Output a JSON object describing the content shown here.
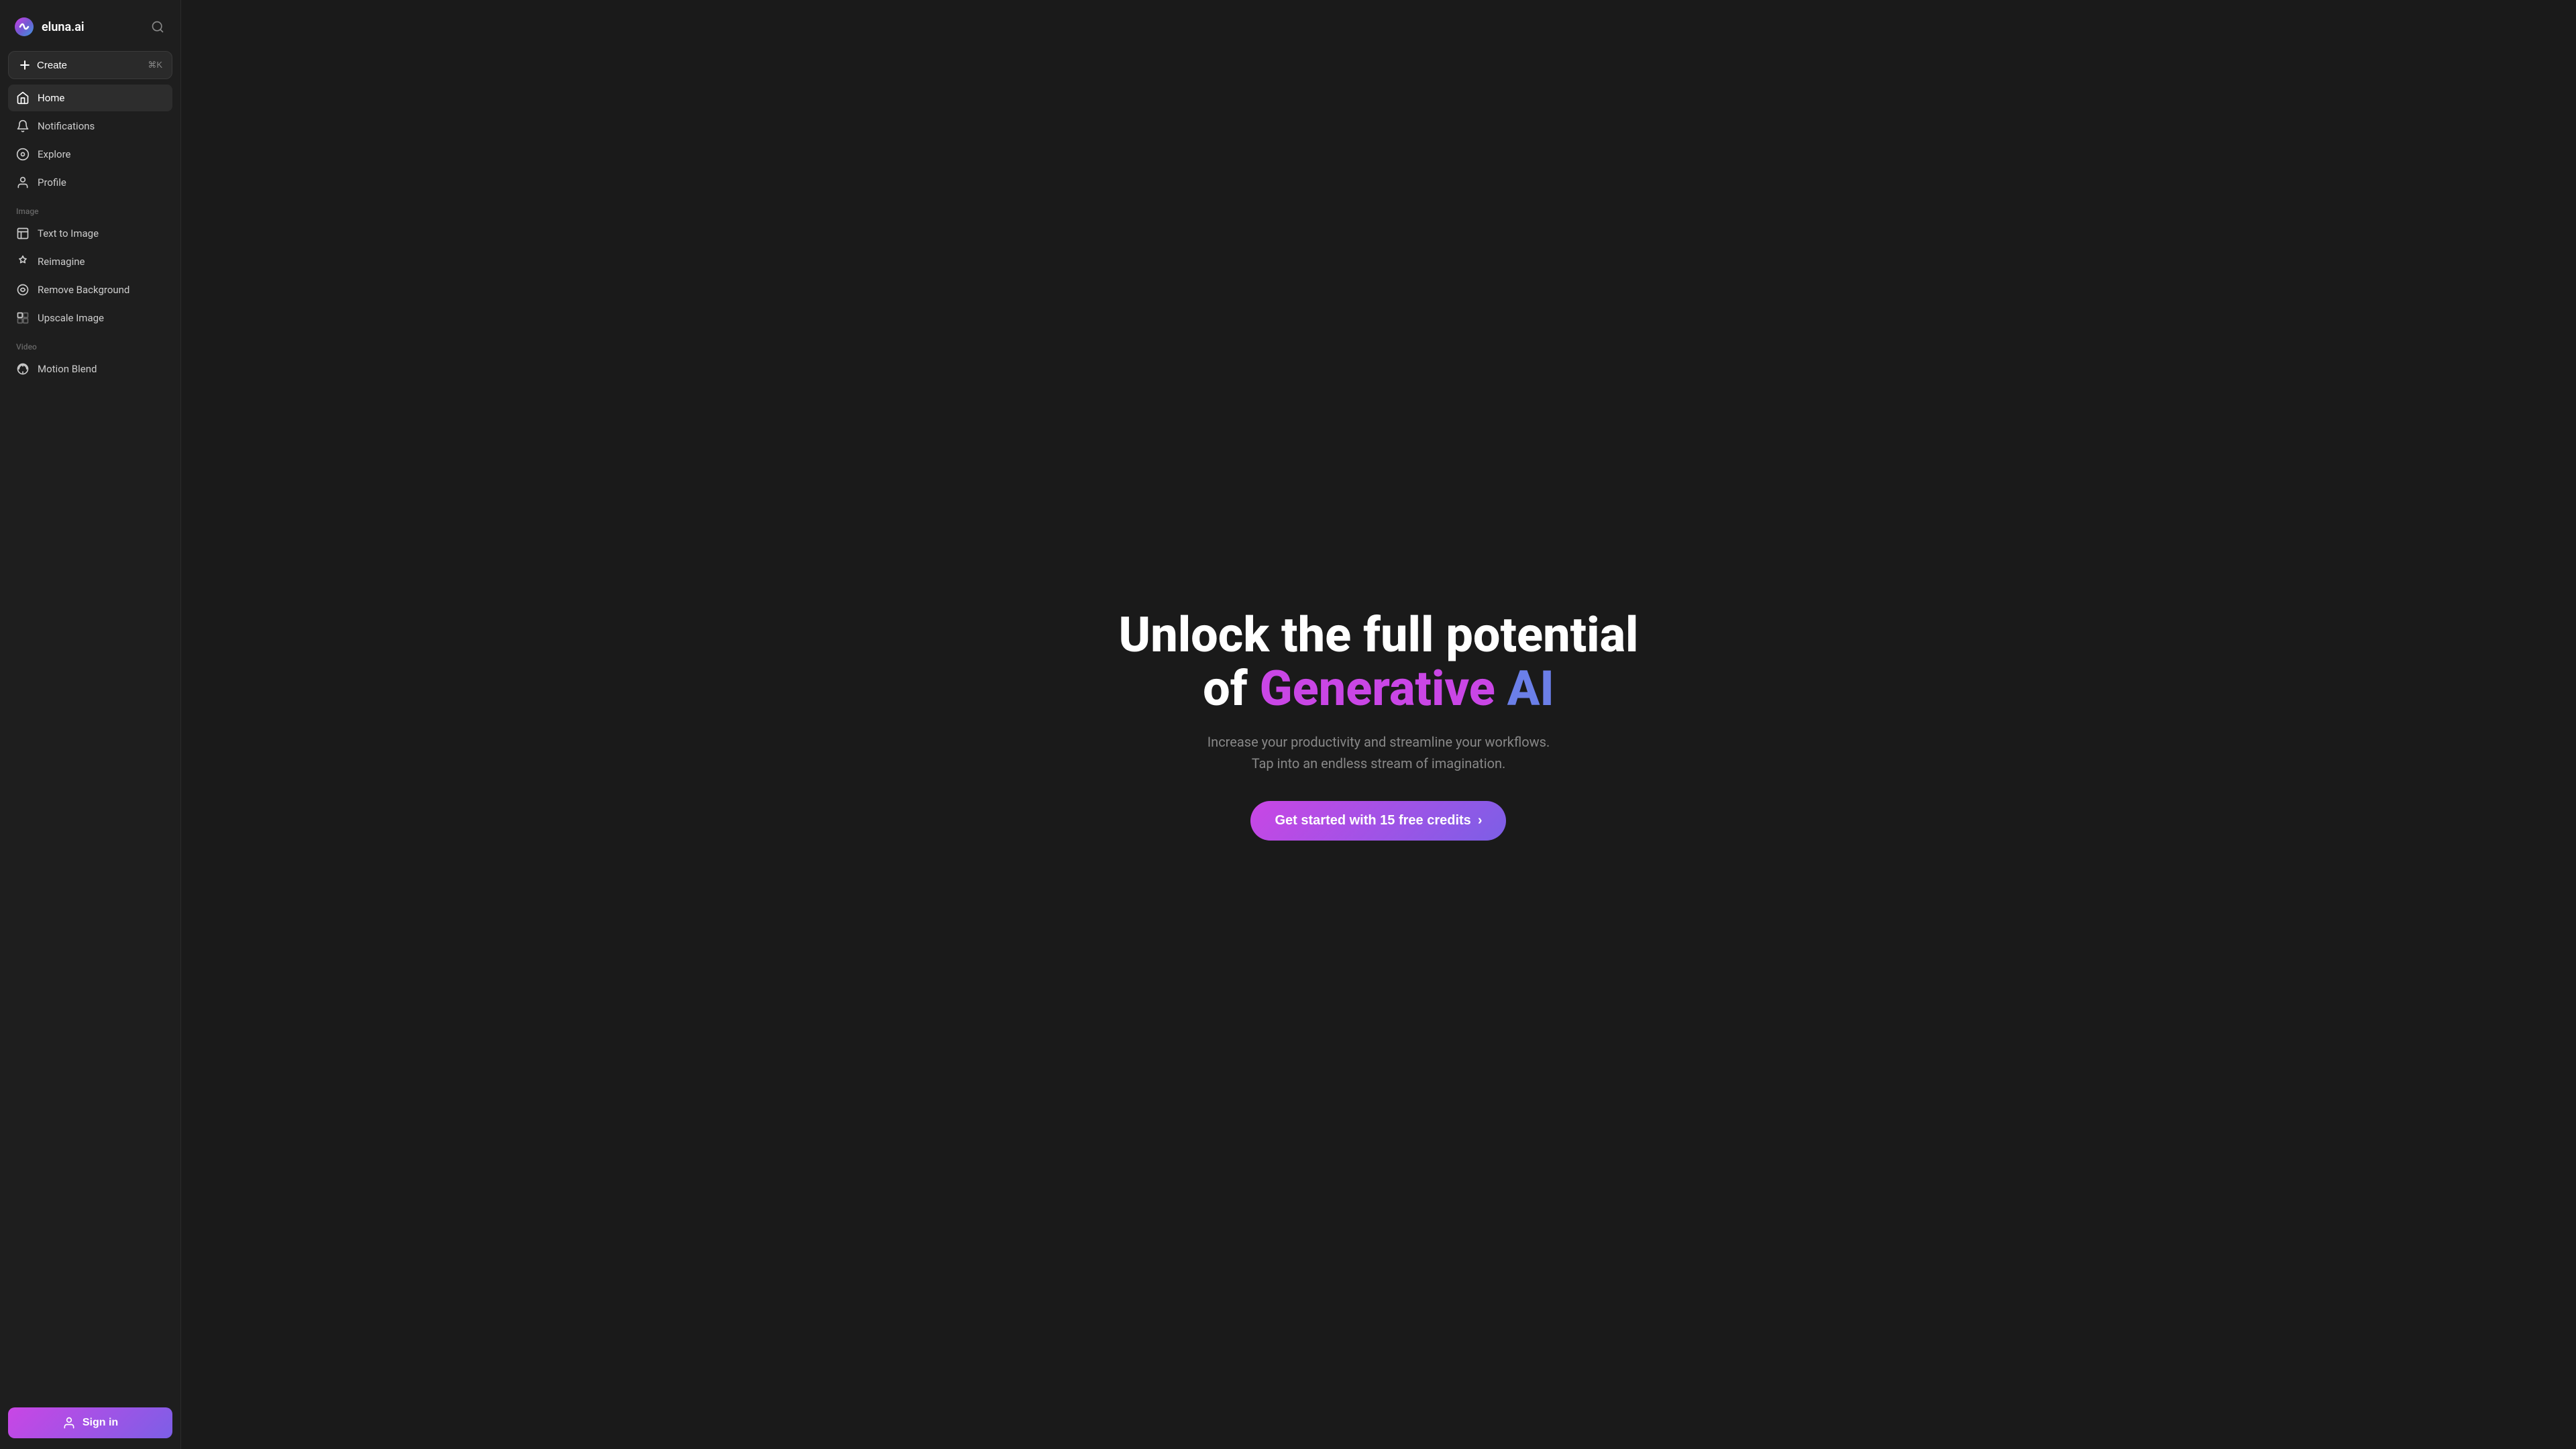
{
  "app": {
    "name": "eluna.ai",
    "logo_alt": "eluna.ai logo"
  },
  "sidebar": {
    "create_label": "Create",
    "create_shortcut": "⌘K",
    "nav_items": [
      {
        "id": "home",
        "label": "Home",
        "icon": "home-icon",
        "active": true
      },
      {
        "id": "notifications",
        "label": "Notifications",
        "icon": "bell-icon",
        "active": false
      },
      {
        "id": "explore",
        "label": "Explore",
        "icon": "circle-icon",
        "active": false
      },
      {
        "id": "profile",
        "label": "Profile",
        "icon": "user-icon",
        "active": false
      }
    ],
    "image_section_label": "Image",
    "image_items": [
      {
        "id": "text-to-image",
        "label": "Text to Image",
        "icon": "image-gen-icon"
      },
      {
        "id": "reimagine",
        "label": "Reimagine",
        "icon": "sparkle-icon"
      },
      {
        "id": "remove-background",
        "label": "Remove Background",
        "icon": "scissors-icon"
      },
      {
        "id": "upscale-image",
        "label": "Upscale Image",
        "icon": "upscale-icon"
      }
    ],
    "video_section_label": "Video",
    "video_items": [
      {
        "id": "motion-blend",
        "label": "Motion Blend",
        "icon": "motion-icon"
      }
    ],
    "sign_in_label": "Sign in"
  },
  "hero": {
    "title_line1": "Unlock the full potential",
    "title_line2_plain": "of ",
    "title_highlight_purple": "Generative",
    "title_highlight_blue": " AI",
    "subtitle_line1": "Increase your productivity and streamline your workflows.",
    "subtitle_line2": "Tap into an endless stream of imagination.",
    "cta_label": "Get started with 15 free credits",
    "cta_chevron": "›"
  }
}
